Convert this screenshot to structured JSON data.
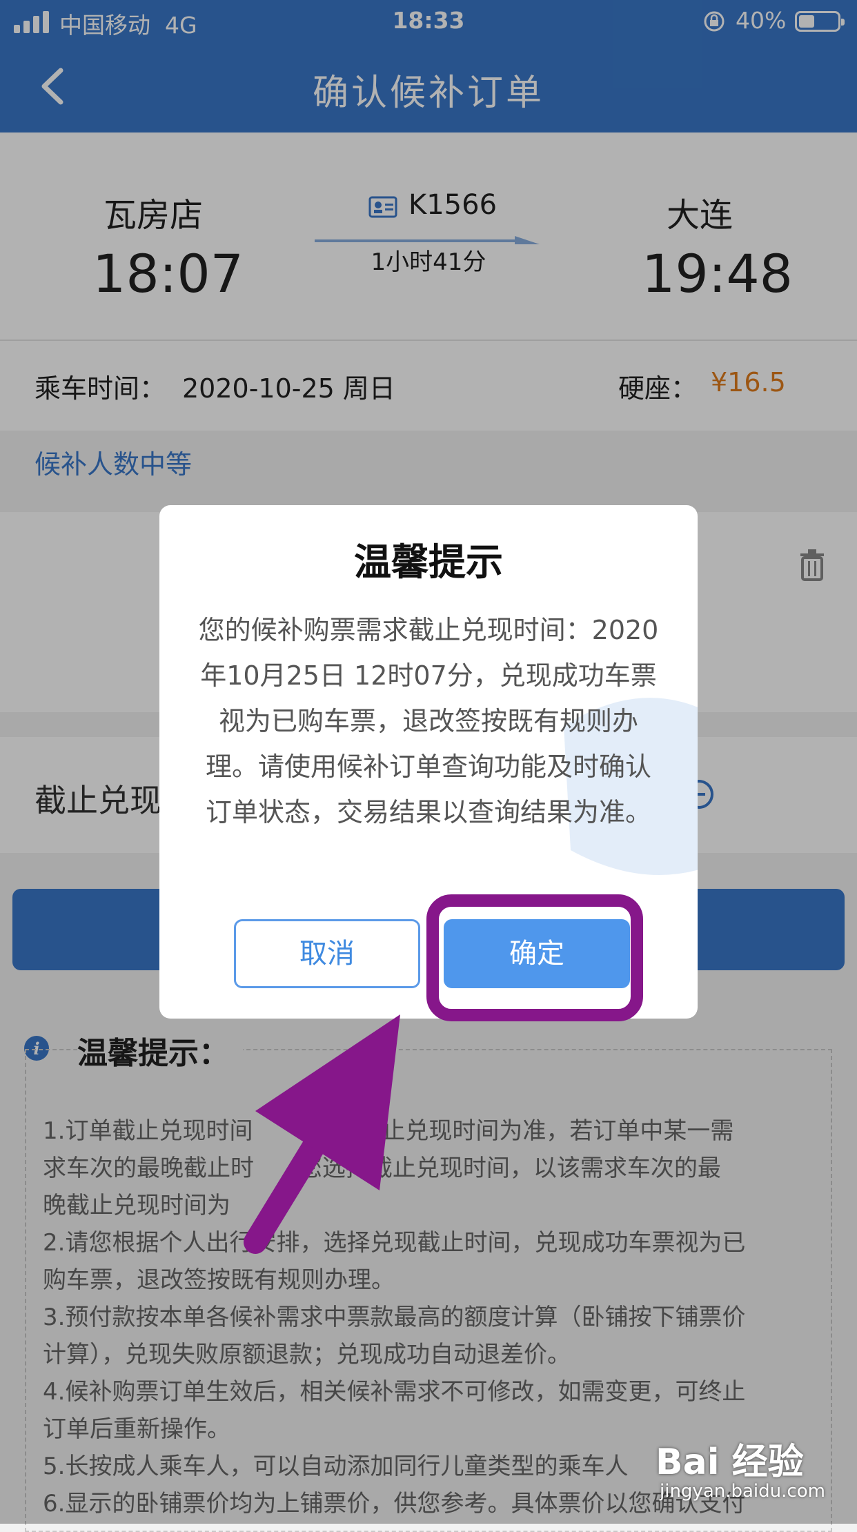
{
  "status_bar": {
    "carrier": "中国移动",
    "network": "4G",
    "time": "18:33",
    "battery": "40%"
  },
  "nav": {
    "title": "确认候补订单"
  },
  "trip": {
    "from_station": "瓦房店",
    "depart_time": "18:07",
    "train_no": "K1566",
    "duration": "1小时41分",
    "to_station": "大连",
    "arrive_time": "19:48"
  },
  "info": {
    "date_label": "乘车时间：",
    "date_value": "2020-10-25 周日",
    "seat": "硬座：",
    "price": "¥16.5"
  },
  "status_note": "候补人数中等",
  "deadline": {
    "label": "截止兑现"
  },
  "tips_section": {
    "title": "温馨提示：",
    "items": [
      "1.订单截止兑现时间",
      "的截止兑现时间为准，若订单中某一需",
      "求车次的最晚截止时",
      "您选择截止兑现时间，以该需求车次的最",
      "晚截止兑现时间为",
      "2.请您根据个人出行安排，选择兑现截止时间，兑现成功车票视为已",
      "购车票，退改签按既有规则办理。",
      "3.预付款按本单各候补需求中票款最高的额度计算（卧铺按下铺票价",
      "计算），兑现失败原额退款；兑现成功自动退差价。",
      "4.候补购票订单生效后，相关候补需求不可修改，如需变更，可终止",
      "订单后重新操作。",
      "5.长按成人乘车人，可以自动添加同行儿童类型的乘车人",
      "6.显示的卧铺票价均为上铺票价，供您参考。具体票价以您确认支付"
    ]
  },
  "modal": {
    "title": "温馨提示",
    "message": "您的候补购票需求截止兑现时间：2020年10月25日 12时07分，兑现成功车票视为已购车票，退改签按既有规则办理。请使用候补订单查询功能及时确认订单状态，交易结果以查询结果为准。",
    "cancel": "取消",
    "confirm": "确定"
  },
  "watermark": {
    "brand": "Bai 经验",
    "url": "jingyan.baidu.com"
  },
  "colors": {
    "primary": "#3a78c9",
    "button": "#4f97ec",
    "price": "#e07b1c",
    "highlight": "#86178a"
  }
}
